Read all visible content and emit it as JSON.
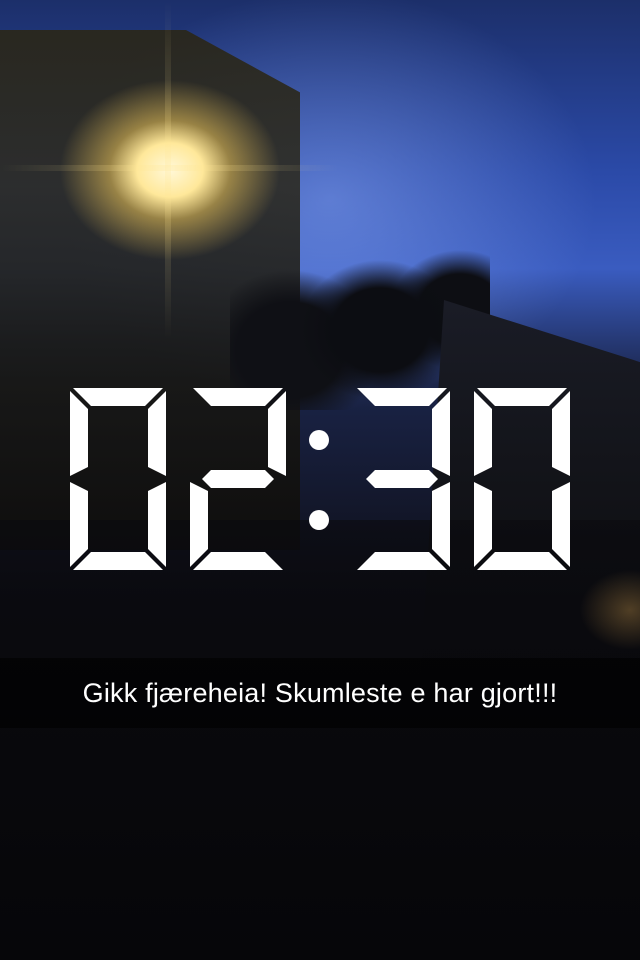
{
  "snap": {
    "time_filter": {
      "hours": "02",
      "minutes": "30",
      "separator": ":",
      "color": "#ffffff"
    },
    "caption": {
      "text": "Gikk fjæreheia! Skumleste e har gjort!!!",
      "bar_color": "rgba(0,0,0,0.6)",
      "text_color": "#ffffff"
    }
  }
}
